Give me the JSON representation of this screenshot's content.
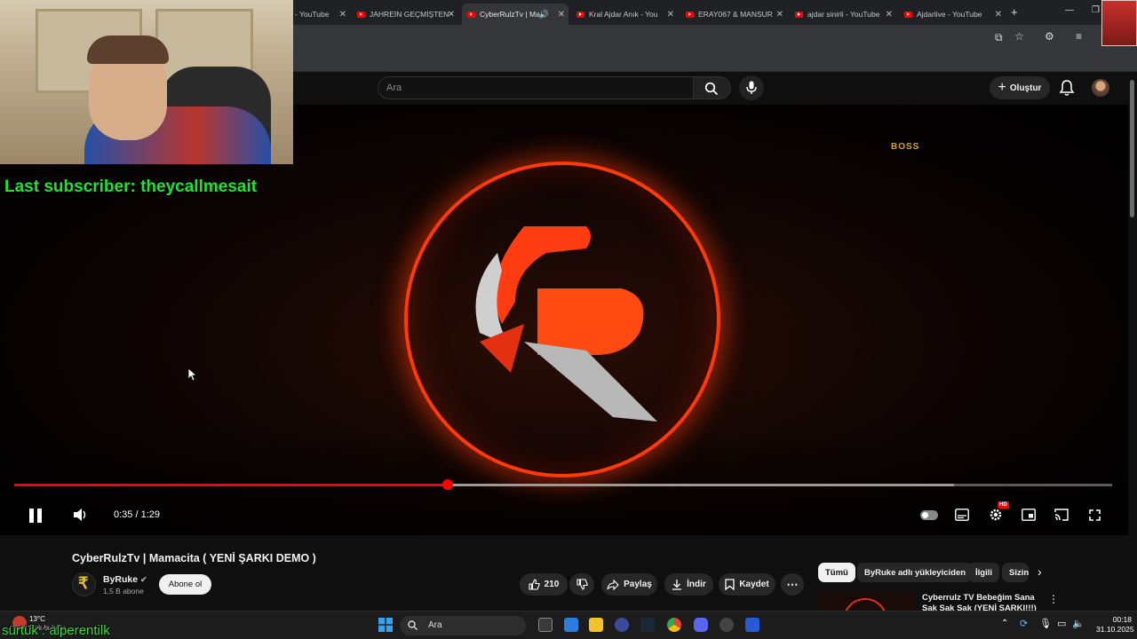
{
  "browser": {
    "tabs": [
      {
        "label": "- YouTube"
      },
      {
        "label": "JAHREİN GEÇMİŞTEN"
      },
      {
        "label": "CyberRulzTv | Ma"
      },
      {
        "label": "Kral Ajdar Anık - You"
      },
      {
        "label": "ERAY067 & MANSUR"
      },
      {
        "label": "ajdar sinirli - YouTube"
      },
      {
        "label": "Ajdarlive - YouTube"
      }
    ],
    "new_tab": "+"
  },
  "youtube": {
    "search_placeholder": "Ara",
    "create_label": "Oluştur"
  },
  "overlay": {
    "last_subscriber": "Last subscriber: theycallmesait",
    "boss_badge": "BOSS",
    "chat_username": "sürtük : alperentilk"
  },
  "player": {
    "time": "0:35 / 1:29",
    "progress_fraction": 0.395,
    "buffered_fraction": 0.856,
    "hd_badge": "HD"
  },
  "video_info": {
    "title": "CyberRulzTv | Mamacita ( YENİ ŞARKI DEMO )",
    "channel": "ByRuke",
    "subscribers": "1,5 B abone",
    "subscribe_label": "Abone ol",
    "likes": "210",
    "share_label": "Paylaş",
    "download_label": "İndir",
    "save_label": "Kaydet"
  },
  "related": {
    "chips": [
      "Tümü",
      "ByRuke adlı yükleyiciden",
      "İlgili",
      "Sizin"
    ],
    "first_title": "Cyberrulz TV Bebeğim Sana Şak Şak Şak (YENİ ŞARKI!!!)"
  },
  "taskbar": {
    "search_label": "Ara",
    "weather_temp": "13°C",
    "weather_desc": "Çok bulutlu",
    "time": "00:18",
    "date": "31.10.2025"
  },
  "colors": {
    "youtube_red": "#ff0000",
    "overlay_green": "#22e036",
    "glow_orange": "#ff3a0a"
  }
}
